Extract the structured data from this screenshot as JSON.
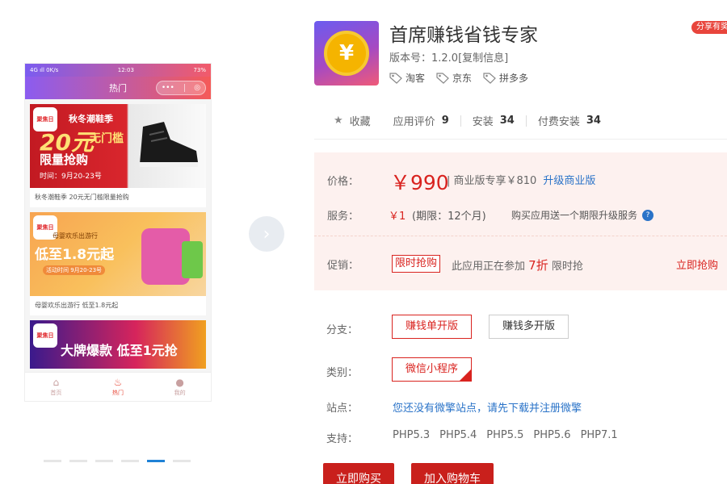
{
  "preview": {
    "status_left": "4G ıll  0K/s",
    "status_time": "12:03",
    "status_right": "73%",
    "nav_title": "热门",
    "capsule_more": "•••",
    "capsule_close": "◎",
    "banners": [
      {
        "logo": "聚焦日",
        "sub": "秋冬潮鞋季",
        "big": "20元",
        "small": "无门槛",
        "mid": "限量抢购",
        "time": "时间：9月20-23号",
        "caption": "秋冬潮鞋季 20元无门槛限量抢购"
      },
      {
        "logo": "聚焦日",
        "sub": "母婴欢乐出游行",
        "big": "低至1.8元起",
        "time": "活动时间 9月20-23号",
        "caption": "母婴欢乐出游行 低至1.8元起"
      },
      {
        "logo": "聚焦日",
        "big": "大牌爆款 低至1元抢"
      }
    ],
    "tabs": [
      {
        "label": "首页",
        "icon": "home-icon"
      },
      {
        "label": "热门",
        "icon": "fire-icon"
      },
      {
        "label": "我的",
        "icon": "user-icon"
      }
    ]
  },
  "carousel": {
    "next_icon": "›",
    "active_dot": 4,
    "dot_count": 6
  },
  "app": {
    "title": "首席赚钱省钱专家",
    "share_label": "分享有奖",
    "version": "版本号：1.2.0[复制信息]",
    "coin_symbol": "¥",
    "tags": [
      "淘客",
      "京东",
      "拼多多"
    ]
  },
  "stats": {
    "favorite": "收藏",
    "review_label": "应用评价",
    "review_count": "9",
    "install_label": "安装",
    "install_count": "34",
    "paid_label": "付费安装",
    "paid_count": "34"
  },
  "pricing": {
    "price_label": "价格：",
    "price": "￥990",
    "commercial": "| 商业版专享￥810",
    "upgrade": "升级商业版",
    "service_label": "服务：",
    "service_price": "￥1",
    "service_period": "(期限：12个月)",
    "service_note": "购买应用送一个期限升级服务",
    "promo_label": "促销：",
    "promo_badge": "限时抢购",
    "promo_prefix": "此应用正在参加",
    "promo_discount": "7折",
    "promo_suffix": "限时抢",
    "promo_link": "立即抢购"
  },
  "options": {
    "branch_label": "分支：",
    "branch_options": [
      "赚钱单开版",
      "赚钱多开版"
    ],
    "category_label": "类别：",
    "category_value": "微信小程序",
    "site_label": "站点：",
    "site_text": "您还没有微擎站点，请先下载并注册微擎",
    "support_label": "支持：",
    "support_versions": [
      "PHP5.3",
      "PHP5.4",
      "PHP5.5",
      "PHP5.6",
      "PHP7.1"
    ]
  },
  "actions": {
    "buy_now": "立即购买",
    "add_cart": "加入购物车"
  },
  "colors": {
    "accent_red": "#d9231f",
    "link_blue": "#2a73c8",
    "price_bg": "#fdf1ef"
  }
}
